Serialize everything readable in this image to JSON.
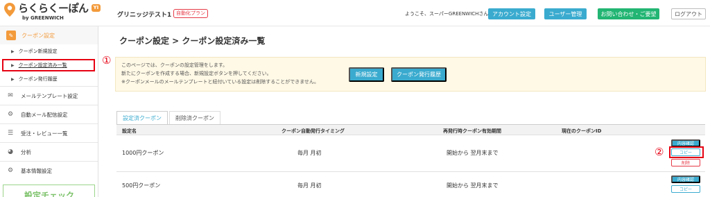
{
  "header": {
    "logo_text": "らくらくーぽん",
    "logo_sub": "by GREENWICH",
    "logo_badge": "YI",
    "shop_name": "グリニッジテスト1",
    "plan_badge": "自動化プラン",
    "welcome": "ようこそ、スーパーGREENWICHさん",
    "account_button": "アカウント設定",
    "users_button": "ユーザー管理",
    "contact_button": "お問い合わせ・ご要望",
    "logout_button": "ログアウト"
  },
  "sidebar": {
    "section_label": "クーポン設定",
    "sub_items": [
      {
        "label": "クーポン新規設定"
      },
      {
        "label": "クーポン設定済み一覧"
      },
      {
        "label": "クーポン発行履歴"
      }
    ],
    "menu_items": [
      {
        "label": "メールテンプレート設定",
        "icon": "mail-icon"
      },
      {
        "label": "自動メール配信設定",
        "icon": "gear-icon"
      },
      {
        "label": "受注・レビュー一覧",
        "icon": "list-icon"
      },
      {
        "label": "分析",
        "icon": "pie-chart-icon"
      },
      {
        "label": "基本情報設定",
        "icon": "gear-icon"
      }
    ],
    "bottom_banner": "設定チェック"
  },
  "main": {
    "title": "クーポン設定 > クーポン設定済み一覧",
    "annotation_1": "①",
    "annotation_2": "②",
    "info_lines": [
      "このページでは、クーポンの設定管理をします。",
      "新たにクーポンを作成する場合、新規設定ボタンを押してください。",
      "※クーポンメールのメールテンプレートと紐付いている設定は削除することができません。"
    ],
    "new_button": "新規設定",
    "history_button": "クーポン発行履歴",
    "tabs": [
      {
        "label": "設定済クーポン"
      },
      {
        "label": "削除済クーポン"
      }
    ],
    "columns": [
      "設定名",
      "クーポン自動発行タイミング",
      "再発行時クーポン有効期間",
      "現在のクーポンID"
    ],
    "rows": [
      {
        "name": "1000円クーポン",
        "timing": "毎月 月初",
        "period": "開始から 翌月末まで",
        "coupon_id": "",
        "detail": "内容確認",
        "copy": "コピー",
        "delete": "削除"
      },
      {
        "name": "500円クーポン",
        "timing": "毎月 月初",
        "period": "開始から 翌月末まで",
        "coupon_id": "",
        "detail": "内容確認",
        "copy": "コピー"
      }
    ]
  },
  "colors": {
    "accent_orange": "#f39a3b",
    "button_blue": "#3aabcf",
    "button_green": "#22b573",
    "highlight_red": "#e60012",
    "info_bg": "#fff9e6"
  }
}
